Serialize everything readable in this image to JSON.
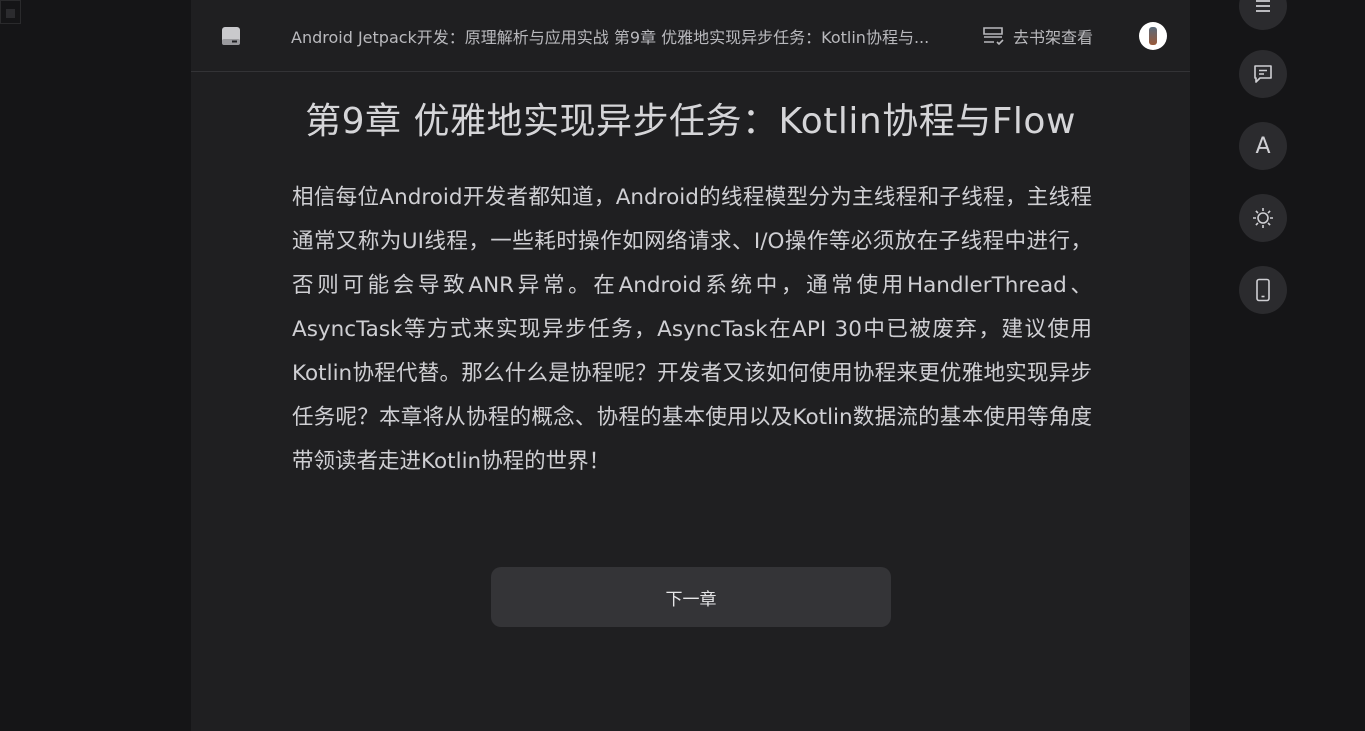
{
  "header": {
    "book_title": "Android Jetpack开发：原理解析与应用实战 第9章 优雅地实现异步任务：Kotlin协程与...",
    "shelf_label": "去书架查看"
  },
  "chapter": {
    "title": "第9章 优雅地实现异步任务：Kotlin协程与Flow",
    "body": "相信每位Android开发者都知道，Android的线程模型分为主线程和子线程，主线程通常又称为UI线程，一些耗时操作如网络请求、I/O操作等必须放在子线程中进行，否则可能会导致ANR异常。在Android系统中，通常使用HandlerThread、AsyncTask等方式来实现异步任务，AsyncTask在API 30中已被废弃，建议使用Kotlin协程代替。那么什么是协程呢？开发者又该如何使用协程来更优雅地实现异步任务呢？本章将从协程的概念、协程的基本使用以及Kotlin数据流的基本使用等角度带领读者走进Kotlin协程的世界！"
  },
  "nav": {
    "next_label": "下一章"
  },
  "side_tools": {
    "font_label": "A",
    "icons": [
      "menu-icon",
      "comment-icon",
      "font-icon",
      "brightness-icon",
      "phone-icon"
    ]
  },
  "colors": {
    "page_bg": "#151517",
    "reader_bg": "#1f1f21",
    "button_bg": "#343437",
    "text": "#cfcfd3"
  }
}
